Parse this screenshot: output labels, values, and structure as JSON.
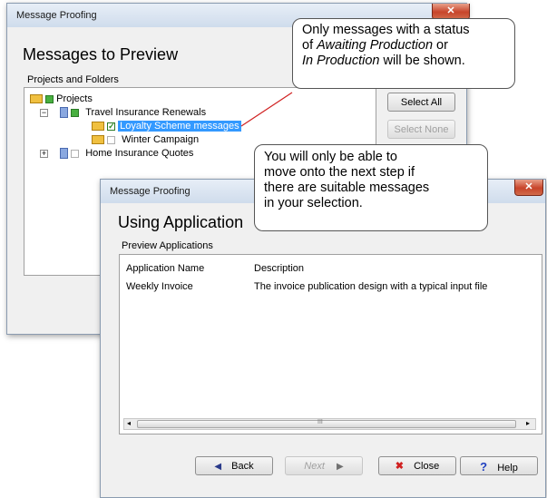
{
  "back_window": {
    "title": "Message Proofing",
    "heading": "Messages to Preview",
    "section_label": "Projects and Folders",
    "tree": [
      {
        "label": "Projects"
      },
      {
        "label": "Travel Insurance Renewals"
      },
      {
        "label": "Loyalty Scheme messages",
        "selected": true
      },
      {
        "label": "Winter Campaign"
      },
      {
        "label": "Home Insurance Quotes"
      }
    ],
    "select_all_label": "Select All",
    "select_none_label": "Select None"
  },
  "front_window": {
    "title": "Message Proofing",
    "close_glyph": "✕",
    "heading": "Using Application",
    "section_label": "Preview Applications",
    "columns": [
      "Application Name",
      "Description"
    ],
    "rows": [
      {
        "name": "Weekly Invoice",
        "description": "The invoice publication design with a typical input file"
      }
    ],
    "scroll_center": "III",
    "buttons": {
      "back": "Back",
      "next": "Next",
      "close": "Close",
      "help": "Help"
    }
  },
  "callouts": {
    "top": {
      "line1": "Only messages with a status",
      "line2_prefix": "of ",
      "line2_italic": "Awaiting Production",
      "line2_suffix": " or",
      "line3_italic": "In Production",
      "line3_suffix": " will be shown."
    },
    "middle": {
      "lines": [
        "You will only be able to",
        "move onto the next step if",
        "there are suitable messages",
        "in your selection."
      ]
    }
  },
  "colors": {
    "selection": "#3399ff",
    "close_red": "#c8442a",
    "leader_line": "#d02020"
  }
}
